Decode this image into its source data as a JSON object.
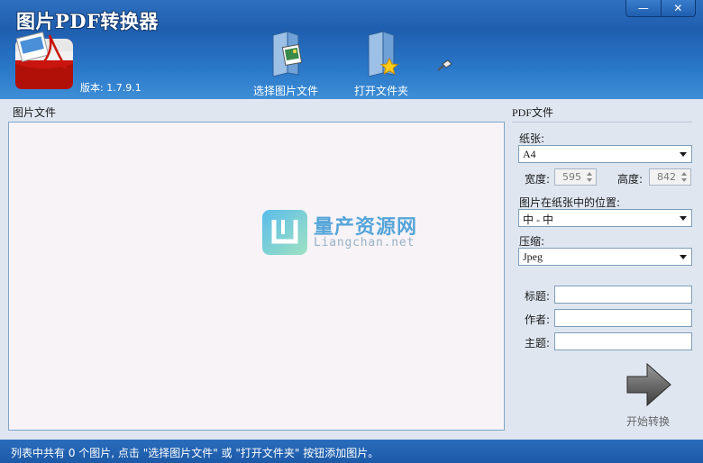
{
  "app": {
    "title": "图片PDF转换器",
    "version": "版本: 1.7.9.1"
  },
  "window": {
    "minimize_glyph": "—",
    "close_glyph": "✕"
  },
  "toolbar": {
    "select_images": "选择图片文件",
    "open_folder": "打开文件夹"
  },
  "left_panel": {
    "title": "图片文件"
  },
  "watermark": {
    "title": "量产资源网",
    "url": "Liangchan.net"
  },
  "right_panel": {
    "title": "PDF文件",
    "paper_label": "纸张:",
    "paper_value": "A4",
    "width_label": "宽度:",
    "width_value": "595",
    "height_label": "高度:",
    "height_value": "842",
    "position_label": "图片在纸张中的位置:",
    "position_value": "中 - 中",
    "compress_label": "压缩:",
    "compress_value": "Jpeg",
    "title_label": "标题:",
    "author_label": "作者:",
    "subject_label": "主题:",
    "start_label": "开始转换"
  },
  "status": {
    "text": "列表中共有 0 个图片, 点击 \"选择图片文件\" 或 \"打开文件夹\" 按钮添加图片。"
  },
  "colors": {
    "header": "#1f5eaf",
    "panel_bg": "#dfe6f0",
    "list_bg": "#f7f3f7",
    "status_bg": "#1c5aa8"
  }
}
